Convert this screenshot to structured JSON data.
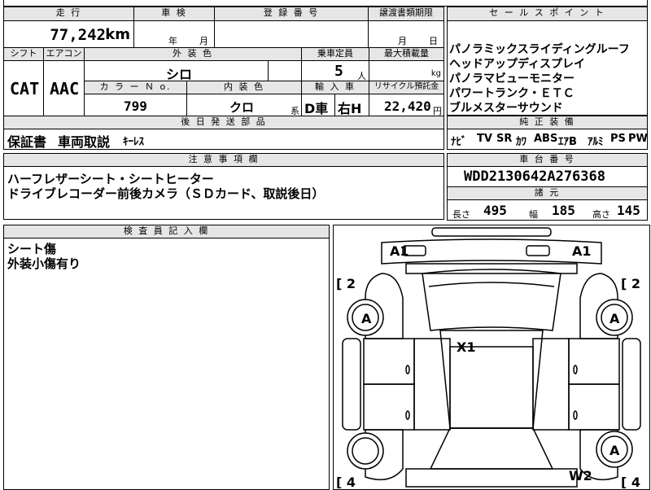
{
  "header_row": {
    "mileage_label": "走 行",
    "shaken_label": "車 検",
    "reg_label": "登 録 番 号",
    "transfer_label": "譲渡書類期限",
    "sales_label": "セ ー ル ス ポ イ ン ト"
  },
  "mileage": {
    "value": "77,242",
    "unit": "km"
  },
  "shaken": {
    "year_unit": "年",
    "month_unit": "月"
  },
  "transfer": {
    "month_unit": "月",
    "day_unit": "日"
  },
  "sales_points": [
    "パノラミックスライディングルーフ",
    "ヘッドアップディスプレイ",
    "パノラマビューモニター",
    "パワートランク・ＥＴＣ",
    "ブルメスターサウンド"
  ],
  "row2_labels": {
    "shift": "シフト",
    "ac": "エアコン",
    "ext_color": "外 装 色",
    "capacity": "乗車定員",
    "max_load": "最大積載量"
  },
  "shift": "CAT",
  "ac": "AAC",
  "ext_color": "シロ",
  "capacity": {
    "value": "5",
    "unit": "人"
  },
  "max_load_unit": "kg",
  "row3_labels": {
    "color_no": "カ ラ ー Ｎ o.",
    "int_color": "内 装 色",
    "import": "輸 入 車",
    "recycle": "リサイクル預託金"
  },
  "color_no": "799",
  "int_color": "クロ",
  "int_suffix": "系",
  "import_d": "D車",
  "import_h": "右H",
  "recycle": {
    "value": "22,420",
    "unit": "円"
  },
  "later_parts": {
    "label": "後 日 発 送 部 品",
    "items": [
      "保証書",
      "車両取説",
      "ｷｰﾚｽ"
    ]
  },
  "equipment": {
    "label": "純 正 装 備",
    "items": [
      "ﾅﾋﾞ",
      "TV",
      "SR",
      "ｶﾜ",
      "ABS",
      "ｴｱB",
      "ｱﾙﾐ",
      "PS",
      "PW"
    ]
  },
  "notes": {
    "label": "注 意 事 項 欄",
    "lines": [
      "ハーフレザーシート・シートヒーター",
      "ドライブレコーダー前後カメラ（ＳＤカード、取説後日）"
    ]
  },
  "chassis": {
    "label": "車 台 番 号",
    "value": "WDD2130642A276368"
  },
  "specs": {
    "label": "諸 元",
    "length_label": "長さ",
    "length": "495",
    "width_label": "幅",
    "width": "185",
    "height_label": "高さ",
    "height": "145"
  },
  "inspector": {
    "label": "検 査 員 記 入 欄",
    "lines": [
      "シート傷",
      "外装小傷有り"
    ]
  },
  "damage_marks": {
    "a1_left": "A1",
    "a1_right": "A1",
    "bracket_tl": "[ 2",
    "bracket_tr": "[ 2",
    "bracket_bl": "[ 4",
    "bracket_br": "[ 4",
    "wheel_fl": "A",
    "wheel_fr": "A",
    "wheel_rr": "A",
    "roof": "X1",
    "rear": "W2"
  }
}
